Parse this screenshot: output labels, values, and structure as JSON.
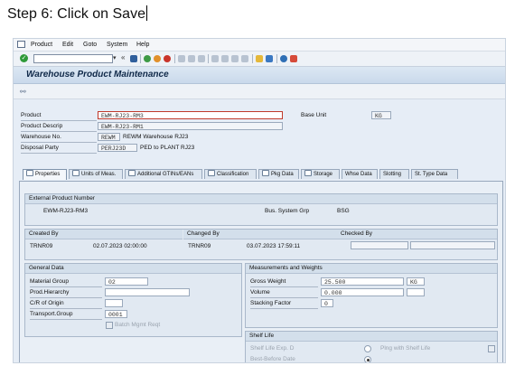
{
  "caption": "Step 6: Click on Save",
  "menu": [
    "Product",
    "Edit",
    "Goto",
    "System",
    "Help"
  ],
  "toolbar": {
    "icons": [
      "enter-icon",
      "save-icon",
      "back-icon",
      "exit-icon",
      "cancel-icon",
      "print-icon",
      "find-icon",
      "find-next-icon",
      "first-page-icon",
      "previous-page-icon",
      "next-page-icon",
      "last-page-icon",
      "create-session-icon",
      "shortcut-icon",
      "help-icon",
      "layout-icon"
    ]
  },
  "title": "Warehouse Product Maintenance",
  "header": {
    "product_label": "Product",
    "product_value": "EWM-RJ23-RM3",
    "base_unit_label": "Base Unit",
    "base_unit_value": "KG",
    "descrip_label": "Product Descrip",
    "descrip_value": "EWM-RJ23-RM1",
    "warehouse_label": "Warehouse No.",
    "warehouse_value": "REWM",
    "warehouse_text": "REWM Warehouse RJ23",
    "disposal_label": "Disposal Party",
    "disposal_value": "PERJ23D",
    "disposal_text": "PED to PLANT RJ23"
  },
  "tabs": [
    "Properties",
    "Units of Meas.",
    "Additional GTINs/EANs",
    "Classification",
    "Pkg Data",
    "Storage",
    "Whse Data",
    "Slotting",
    "St. Type Data"
  ],
  "ext": {
    "header": "External Product Number",
    "value": "EWM-RJ23-RM3",
    "bus_label": "Bus. System Grp",
    "bus_value": "BSG"
  },
  "admin": {
    "created_header": "Created By",
    "created_user": "TRNR09",
    "created_time": "02.07.2023 02:00:00",
    "changed_header": "Changed By",
    "changed_user": "TRNR09",
    "changed_time": "03.07.2023 17:59:11",
    "checked_header": "Checked By"
  },
  "general": {
    "header": "General Data",
    "matgroup_label": "Material Group",
    "matgroup_value": "02",
    "prodhier_label": "Prod.Hierarchy",
    "cor_label": "C/R of Origin",
    "transport_label": "Transport.Group",
    "transport_value": "0001",
    "batch_label": "Batch Mgmt Reqt"
  },
  "measure": {
    "header": "Measurements and Weights",
    "gross_label": "Gross Weight",
    "gross_value": "25.500",
    "gross_unit": "KG",
    "volume_label": "Volume",
    "volume_value": "0.000",
    "stacking_label": "Stacking Factor",
    "stacking_value": "0"
  },
  "shelf": {
    "header": "Shelf Life",
    "exp_label": "Shelf Life Exp. D",
    "ping_label": "Plng with Shelf Life",
    "best_label": "Best-Before Date"
  }
}
